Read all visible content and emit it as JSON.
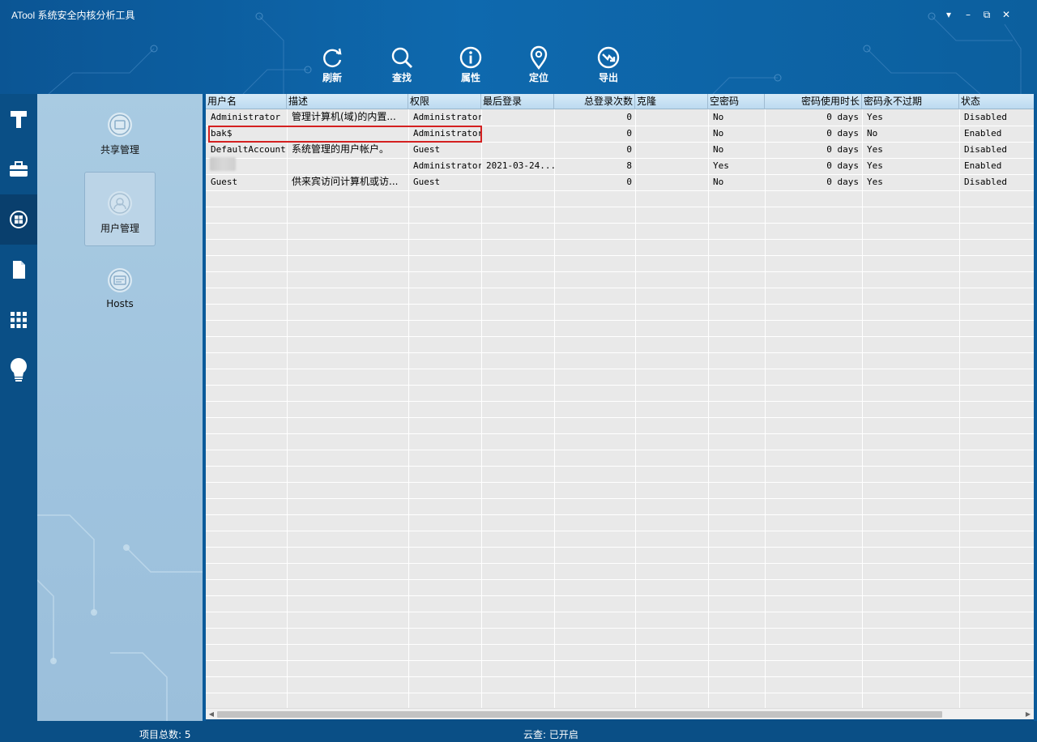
{
  "app": {
    "title": "ATool 系统安全内核分析工具"
  },
  "window_controls": {
    "menu": "▾",
    "minimize": "–",
    "restore": "⧉",
    "close": "✕"
  },
  "toolbar": [
    {
      "label": "刷新",
      "icon": "refresh-icon"
    },
    {
      "label": "查找",
      "icon": "search-icon"
    },
    {
      "label": "属性",
      "icon": "info-icon"
    },
    {
      "label": "定位",
      "icon": "location-icon"
    },
    {
      "label": "导出",
      "icon": "export-icon"
    }
  ],
  "rail": [
    {
      "icon": "hammer-icon"
    },
    {
      "icon": "toolbox-icon"
    },
    {
      "icon": "windows-icon",
      "active": true
    },
    {
      "icon": "document-icon"
    },
    {
      "icon": "apps-grid-icon"
    },
    {
      "icon": "lightbulb-icon"
    }
  ],
  "modules": [
    {
      "label": "共享管理",
      "icon": "share-module-icon"
    },
    {
      "label": "用户管理",
      "icon": "user-module-icon",
      "active": true
    },
    {
      "label": "Hosts",
      "icon": "hosts-module-icon"
    }
  ],
  "grid": {
    "columns": [
      "用户名",
      "描述",
      "权限",
      "最后登录",
      "总登录次数",
      "克隆",
      "空密码",
      "密码使用时长",
      "密码永不过期",
      "状态"
    ],
    "rows": [
      [
        "Administrator",
        "管理计算机(域)的内置...",
        "Administrator",
        "",
        "0",
        "",
        "No",
        "0 days",
        "Yes",
        "Disabled"
      ],
      [
        "bak$",
        "",
        "Administrator",
        "",
        "0",
        "",
        "No",
        "0 days",
        "No",
        "Enabled"
      ],
      [
        "DefaultAccount",
        "系统管理的用户帐户。",
        "Guest",
        "",
        "0",
        "",
        "No",
        "0 days",
        "Yes",
        "Disabled"
      ],
      [
        "",
        "",
        "Administrator",
        "2021-03-24...",
        "8",
        "",
        "Yes",
        "0 days",
        "Yes",
        "Enabled"
      ],
      [
        "Guest",
        "供来宾访问计算机或访...",
        "Guest",
        "",
        "0",
        "",
        "No",
        "0 days",
        "Yes",
        "Disabled"
      ]
    ]
  },
  "status": {
    "total": "项目总数: 5",
    "cloud": "云查: 已开启"
  },
  "colors": {
    "accent": "#0c5f9e",
    "highlight": "#d42020",
    "panel": "#a9cbe2"
  }
}
